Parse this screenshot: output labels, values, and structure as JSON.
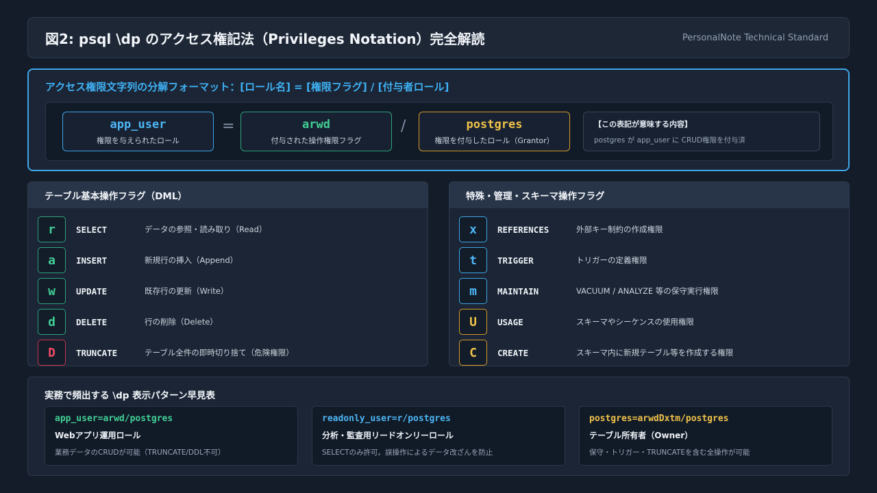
{
  "header": {
    "title": "図2: psql \\dp のアクセス権記法（Privileges Notation）完全解読",
    "brand": "PersonalNote Technical Standard"
  },
  "format": {
    "title": "アクセス権限文字列の分解フォーマット：[ロール名] = [権限フラグ] / [付与者ロール]",
    "role": {
      "code": "app_user",
      "desc": "権限を与えられたロール"
    },
    "equals": "=",
    "flags": {
      "code": "arwd",
      "desc": "付与された操作権限フラグ"
    },
    "slash": "/",
    "grantor": {
      "code": "postgres",
      "desc": "権限を付与したロール（Grantor）"
    },
    "meaning": {
      "heading": "【この表記が意味する内容】",
      "text": "postgres が app_user に CRUD権限を付与済"
    }
  },
  "dml": {
    "title": "テーブル基本操作フラグ（DML）",
    "rows": [
      {
        "flag": "r",
        "op": "SELECT",
        "desc": "データの参照・読み取り（Read）"
      },
      {
        "flag": "a",
        "op": "INSERT",
        "desc": "新規行の挿入（Append）"
      },
      {
        "flag": "w",
        "op": "UPDATE",
        "desc": "既存行の更新（Write）"
      },
      {
        "flag": "d",
        "op": "DELETE",
        "desc": "行の削除（Delete）"
      },
      {
        "flag": "D",
        "op": "TRUNCATE",
        "desc": "テーブル全件の即時切り捨て（危険権限）"
      }
    ]
  },
  "special": {
    "title": "特殊・管理・スキーマ操作フラグ",
    "rows": [
      {
        "flag": "x",
        "op": "REFERENCES",
        "desc": "外部キー制約の作成権限"
      },
      {
        "flag": "t",
        "op": "TRIGGER",
        "desc": "トリガーの定義権限"
      },
      {
        "flag": "m",
        "op": "MAINTAIN",
        "desc": "VACUUM / ANALYZE 等の保守実行権限"
      },
      {
        "flag": "U",
        "op": "USAGE",
        "desc": "スキーマやシーケンスの使用権限"
      },
      {
        "flag": "C",
        "op": "CREATE",
        "desc": "スキーマ内に新規テーブル等を作成する権限"
      }
    ]
  },
  "patterns": {
    "title": "実務で頻出する \\dp 表示パターン早見表",
    "items": [
      {
        "code": "app_user=arwd/postgres",
        "name": "Webアプリ運用ロール",
        "desc": "業務データのCRUDが可能（TRUNCATE/DDL不可）"
      },
      {
        "code": "readonly_user=r/postgres",
        "name": "分析・監査用リードオンリーロール",
        "desc": "SELECTのみ許可。誤操作によるデータ改ざんを防止"
      },
      {
        "code": "postgres=arwdDxtm/postgres",
        "name": "テーブル所有者（Owner）",
        "desc": "保守・トリガー・TRUNCATEを含む全操作が可能"
      }
    ]
  },
  "colors": {
    "accent_blue": "#4db6f5",
    "accent_green": "#42d096",
    "accent_yellow": "#f0c24a",
    "accent_red": "#ee4b66"
  }
}
